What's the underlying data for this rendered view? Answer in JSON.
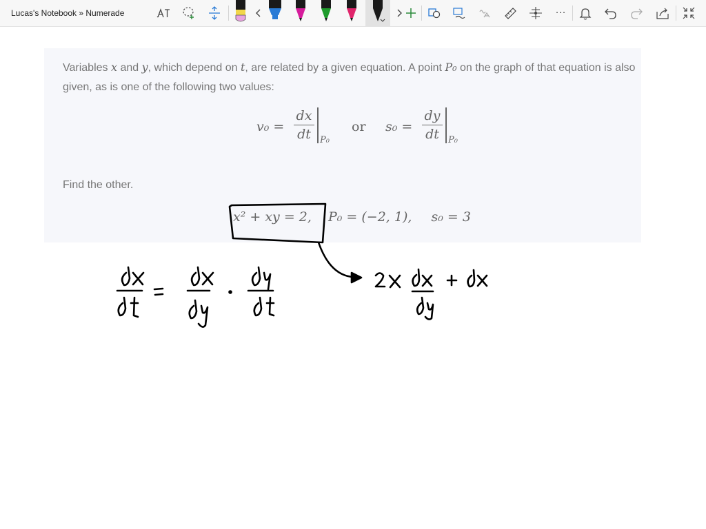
{
  "app": {
    "title": "Lucas's Notebook » Numerade"
  },
  "toolbar": {
    "tools": [
      {
        "name": "type-text-icon"
      },
      {
        "name": "lasso-select-icon"
      },
      {
        "name": "add-space-icon"
      },
      {
        "name": "scroll-left-icon"
      },
      {
        "name": "scroll-right-icon"
      },
      {
        "name": "add-pen-icon"
      },
      {
        "name": "ink-to-shape-icon"
      },
      {
        "name": "ink-to-text-icon"
      },
      {
        "name": "ink-to-math-icon"
      },
      {
        "name": "ruler-icon"
      },
      {
        "name": "replay-icon"
      },
      {
        "name": "more-icon"
      },
      {
        "name": "bell-icon"
      },
      {
        "name": "undo-icon"
      },
      {
        "name": "redo-icon"
      },
      {
        "name": "share-icon"
      },
      {
        "name": "fullscreen-icon"
      }
    ],
    "more_label": "···",
    "pens": [
      {
        "name": "pen-black",
        "color": "#1a1a1a",
        "tip": "#e9a3e0"
      },
      {
        "name": "highlighter-blue",
        "color": "#2a7bd6"
      },
      {
        "name": "pen-magenta",
        "color": "#d61c9c"
      },
      {
        "name": "pen-green",
        "color": "#1f9b2c"
      },
      {
        "name": "pen-pink",
        "color": "#e0256b"
      },
      {
        "name": "pen-black-active",
        "color": "#1a1a1a"
      }
    ]
  },
  "problem": {
    "intro_1": "Variables ",
    "var_x": "x",
    "intro_2": " and ",
    "var_y": "y",
    "intro_3": ", which depend on ",
    "var_t": "t",
    "intro_4": ", are related by a given equation. A point ",
    "var_P0": "P₀",
    "intro_5": " on the graph of that equation is also given, as is one of the following two values:",
    "v0_lhs": "v₀ =",
    "v0_num": "dx",
    "v0_den": "dt",
    "v0_eval": "P₀",
    "or_text": "or",
    "s0_lhs": "s₀ =",
    "s0_num": "dy",
    "s0_den": "dt",
    "s0_eval": "P₀",
    "find_text": "Find the other.",
    "equation": "x² + xy = 2,",
    "point": "P₀ = (−2, 1),",
    "given": "s₀ = 3"
  },
  "colors": {
    "ink": "#000000",
    "card_bg": "#f6f7fb",
    "text_muted": "#777777"
  }
}
